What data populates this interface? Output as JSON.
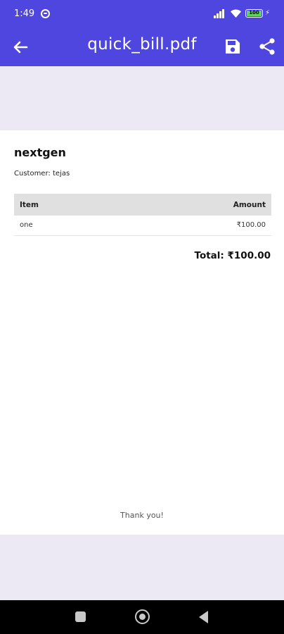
{
  "status_bar": {
    "time": "1:49",
    "battery": "100",
    "accent_color": "#4f46e0"
  },
  "app_bar": {
    "title": "quick_bill.pdf",
    "back_icon": "arrow-left-icon",
    "save_icon": "save-icon",
    "share_icon": "share-icon"
  },
  "invoice": {
    "company": "nextgen",
    "customer_label": "Customer:",
    "customer_name": "tejas",
    "columns": {
      "item": "Item",
      "amount": "Amount"
    },
    "rows": [
      {
        "item": "one",
        "amount": "₹100.00"
      }
    ],
    "total_text": "Total: ₹100.00",
    "footer": "Thank you!"
  },
  "nav_bar": {
    "recents_icon": "square-icon",
    "home_icon": "circle-icon",
    "back_icon": "triangle-back-icon"
  }
}
